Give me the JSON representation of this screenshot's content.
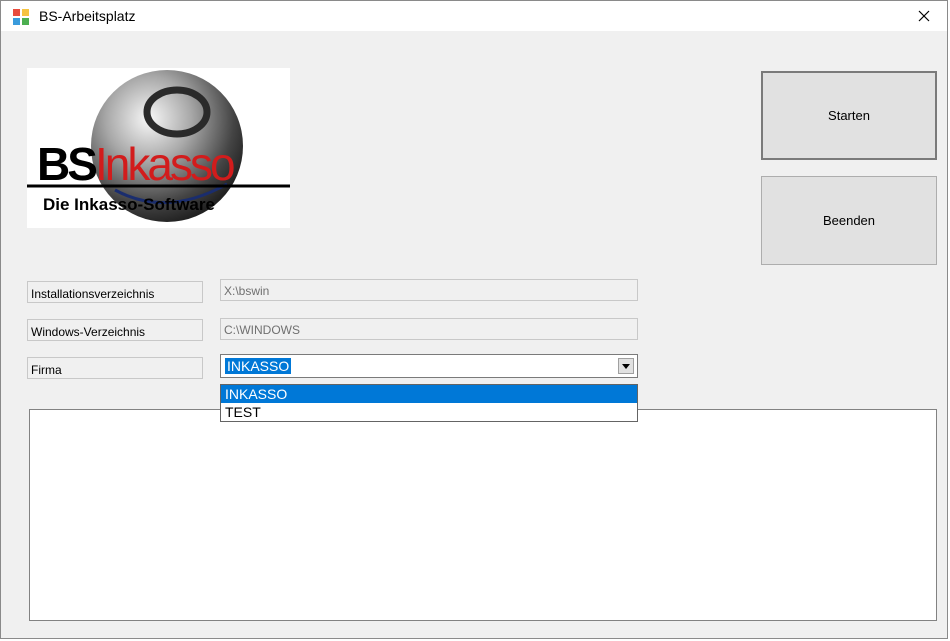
{
  "window": {
    "title": "BS-Arbeitsplatz",
    "close_glyph": "✕"
  },
  "logo": {
    "brand_bs": "BS",
    "brand_inkasso": "Inkasso",
    "tagline": "Die Inkasso-Software"
  },
  "buttons": {
    "start": "Starten",
    "quit": "Beenden"
  },
  "fields": {
    "install_label": "Installationsverzeichnis",
    "install_value": "X:\\bswin",
    "windows_label": "Windows-Verzeichnis",
    "windows_value": "C:\\WINDOWS",
    "company_label": "Firma",
    "company_value": "INKASSO"
  },
  "dropdown": {
    "options": [
      "INKASSO",
      "TEST"
    ],
    "selected": "INKASSO"
  },
  "colors": {
    "selection": "#0078d7",
    "logo_red": "#d21c1c",
    "button_face": "#e1e1e1",
    "window_bg": "#f0f0f0"
  },
  "icons": {
    "app": "app-icon",
    "close": "close-icon",
    "dropdown": "chevron-down-icon"
  }
}
